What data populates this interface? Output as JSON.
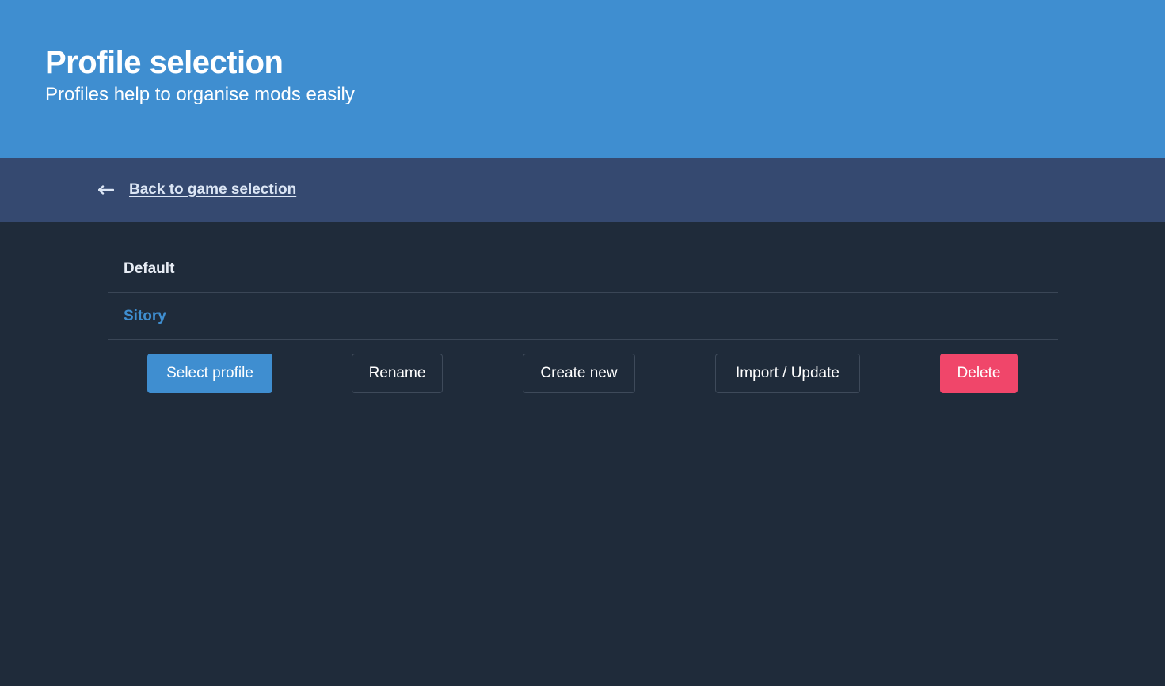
{
  "hero": {
    "title": "Profile selection",
    "subtitle": "Profiles help to organise mods easily",
    "background_color": "#3f8ed0"
  },
  "nav": {
    "back_icon": "arrow-left-icon",
    "back_label": "Back to game selection",
    "background_color": "#354970"
  },
  "profiles": [
    {
      "name": "Default",
      "selected": false
    },
    {
      "name": "Sitory",
      "selected": true
    }
  ],
  "actions": {
    "select_label": "Select profile",
    "rename_label": "Rename",
    "create_label": "Create new",
    "import_label": "Import / Update",
    "delete_label": "Delete"
  },
  "colors": {
    "accent": "#3f8ed0",
    "danger": "#f0466a",
    "page_background": "#1f2b3a"
  }
}
